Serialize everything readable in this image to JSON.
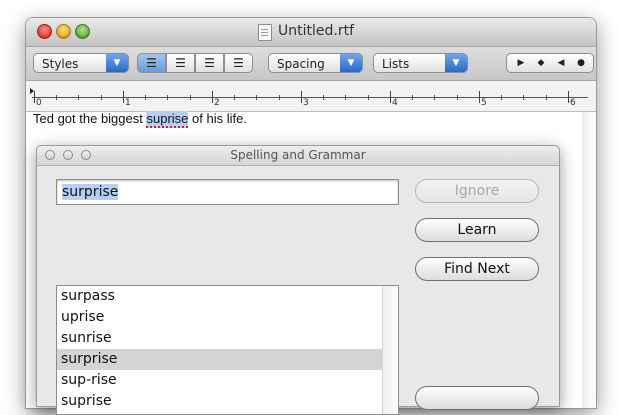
{
  "window": {
    "title": "Untitled.rtf"
  },
  "toolbar": {
    "styles_label": "Styles",
    "spacing_label": "Spacing",
    "lists_label": "Lists"
  },
  "ruler": {
    "numbers": [
      "0",
      "1",
      "2",
      "3",
      "4",
      "5",
      "6"
    ]
  },
  "document": {
    "text_before": "Ted got the biggest ",
    "misspelled": "suprise",
    "text_after": " of his life."
  },
  "panel": {
    "title": "Spelling and Grammar",
    "input_value": "surprise",
    "buttons": {
      "ignore": "Ignore",
      "learn": "Learn",
      "find_next": "Find Next"
    },
    "suggestions": [
      "surpass",
      "uprise",
      "sunrise",
      "surprise",
      "sup-rise",
      "suprise"
    ],
    "selected_suggestion": "surprise"
  },
  "colors": {
    "selection": "#b5d0f3",
    "accent": "#2b67c8",
    "misspell_underline": "#d4202a"
  }
}
